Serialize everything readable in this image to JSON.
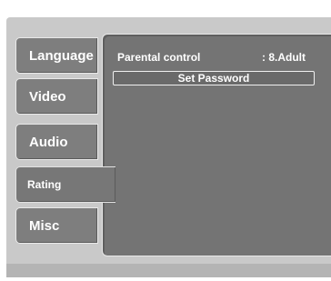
{
  "menu": {
    "tabs": [
      {
        "label": "Language"
      },
      {
        "label": "Video"
      },
      {
        "label": "Audio"
      },
      {
        "label": "Rating"
      },
      {
        "label": "Misc"
      }
    ],
    "selected_tab": "Rating"
  },
  "panel": {
    "parental_control_label": "Parental control",
    "parental_control_value": ": 8.Adult",
    "set_password_label": "Set Password"
  },
  "colors": {
    "frame": "#c9c9c9",
    "tab": "#7e7e7e",
    "panel": "#747474",
    "text": "#ffffff"
  }
}
